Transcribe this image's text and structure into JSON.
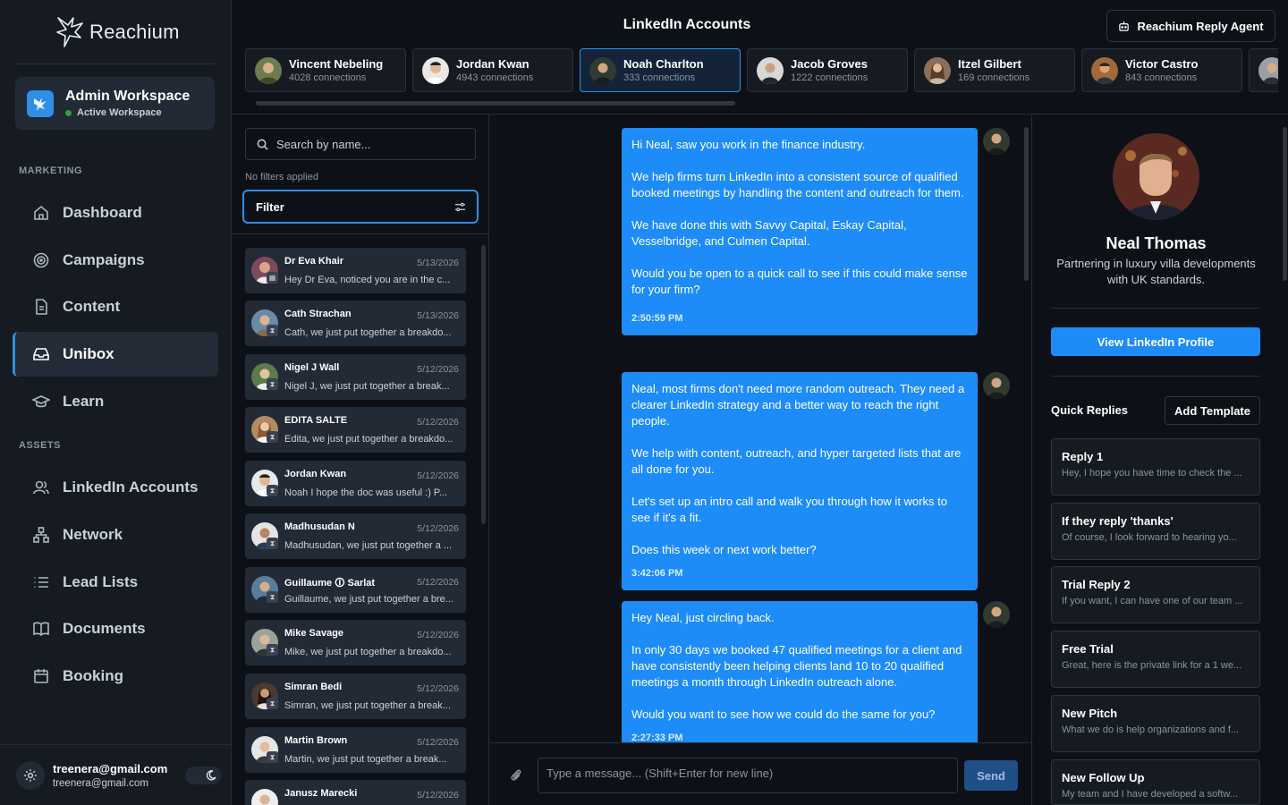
{
  "app": {
    "name": "Reachium"
  },
  "workspace": {
    "title": "Admin Workspace",
    "status": "Active Workspace"
  },
  "sidebar": {
    "sections": {
      "marketing": "MARKETING",
      "assets": "ASSETS"
    },
    "items": [
      {
        "label": "Dashboard",
        "icon": "home-icon"
      },
      {
        "label": "Campaigns",
        "icon": "target-icon"
      },
      {
        "label": "Content",
        "icon": "document-icon"
      },
      {
        "label": "Unibox",
        "icon": "inbox-icon",
        "active": true
      },
      {
        "label": "Learn",
        "icon": "graduation-cap-icon"
      },
      {
        "label": "LinkedIn Accounts",
        "icon": "users-icon"
      },
      {
        "label": "Network",
        "icon": "network-icon"
      },
      {
        "label": "Lead Lists",
        "icon": "list-icon"
      },
      {
        "label": "Documents",
        "icon": "book-icon"
      },
      {
        "label": "Booking",
        "icon": "calendar-icon"
      }
    ]
  },
  "user": {
    "name": "treenera@gmail.com",
    "email": "treenera@gmail.com"
  },
  "header": {
    "title": "LinkedIn Accounts",
    "agent_button": "Reachium Reply Agent"
  },
  "accounts": [
    {
      "name": "Vincent Nebeling",
      "connections": "4028 connections"
    },
    {
      "name": "Jordan Kwan",
      "connections": "4943 connections"
    },
    {
      "name": "Noah Charlton",
      "connections": "333 connections",
      "active": true
    },
    {
      "name": "Jacob Groves",
      "connections": "1222 connections"
    },
    {
      "name": "Itzel Gilbert",
      "connections": "169 connections"
    },
    {
      "name": "Victor Castro",
      "connections": "843 connections"
    }
  ],
  "list": {
    "search_placeholder": "Search by name...",
    "filters_text": "No filters applied",
    "filter_label": "Filter",
    "conversations": [
      {
        "name": "Dr Eva Khair",
        "date": "5/13/2026",
        "preview": "Hey Dr Eva, noticed you are in the c..."
      },
      {
        "name": "Cath Strachan",
        "date": "5/13/2026",
        "preview": "Cath, we just put together a breakdo..."
      },
      {
        "name": "Nigel J Wall",
        "date": "5/12/2026",
        "preview": "Nigel J, we just put together a break..."
      },
      {
        "name": "EDITA SALTE",
        "date": "5/12/2026",
        "preview": "Edita, we just put together a breakdo..."
      },
      {
        "name": "Jordan Kwan",
        "date": "5/12/2026",
        "preview": "Noah I hope the doc was useful :) P..."
      },
      {
        "name": "Madhusudan N",
        "date": "5/12/2026",
        "preview": "Madhusudan, we just put together a ..."
      },
      {
        "name": "Guillaume 🛈 Sarlat",
        "date": "5/12/2026",
        "preview": "Guillaume, we just put together a bre..."
      },
      {
        "name": "Mike Savage",
        "date": "5/12/2026",
        "preview": "Mike, we just put together a breakdo..."
      },
      {
        "name": "Simran Bedi",
        "date": "5/12/2026",
        "preview": "Simran, we just put together a break..."
      },
      {
        "name": "Martin Brown",
        "date": "5/12/2026",
        "preview": "Martin, we just put together a break..."
      },
      {
        "name": "Janusz Marecki",
        "date": "5/12/2026",
        "preview": ""
      }
    ]
  },
  "chat": {
    "messages": [
      {
        "paragraphs": [
          "Hi Neal, saw you work in the finance industry.",
          "We help firms turn LinkedIn into a consistent source of qualified booked meetings by handling the content and outreach for them.",
          "We have done this with Savvy Capital, Eskay Capital, Vesselbridge, and Culmen Capital.",
          "Would you be open to a quick call to see if this could make sense for your firm?"
        ],
        "time": "2:50:59 PM"
      },
      {
        "paragraphs": [
          "Neal, most firms don't need more random outreach. They need a clearer LinkedIn strategy and a better way to reach the right people.",
          "We help with content, outreach, and hyper targeted lists that are all done for you.",
          "Let's set up an intro call and walk you through how it works to see if it's a fit.",
          "Does this week or next work better?"
        ],
        "time": "3:42:06 PM"
      },
      {
        "paragraphs": [
          "Hey Neal, just circling back.",
          "In only 30 days we booked 47 qualified meetings for a client and have consistently been helping clients land 10 to 20 qualified meetings a month through LinkedIn outreach alone.",
          "Would you want to see how we could do the same for you?"
        ],
        "time": "2:27:33 PM"
      }
    ],
    "input_placeholder": "Type a message... (Shift+Enter for new line)",
    "send_label": "Send"
  },
  "profile": {
    "name": "Neal Thomas",
    "headline": "Partnering in luxury villa developments with UK standards.",
    "view_button": "View LinkedIn Profile",
    "quick_replies_title": "Quick Replies",
    "add_template": "Add Template",
    "quick_replies": [
      {
        "name": "Reply 1",
        "text": "Hey, I hope you have time to check the ..."
      },
      {
        "name": "If they reply 'thanks'",
        "text": "Of course, I look forward to hearing yo..."
      },
      {
        "name": "Trial Reply 2",
        "text": "If you want, I can have one of our team ..."
      },
      {
        "name": "Free Trial",
        "text": "Great, here is the private link for a 1 we..."
      },
      {
        "name": "New Pitch",
        "text": "What we do is help organizations and f..."
      },
      {
        "name": "New Follow Up",
        "text": "My team and I have developed a softw..."
      }
    ]
  },
  "colors": {
    "accent": "#1d8cf8",
    "background": "#0d1117",
    "panel": "#161b22",
    "active_green": "#2ea043"
  }
}
